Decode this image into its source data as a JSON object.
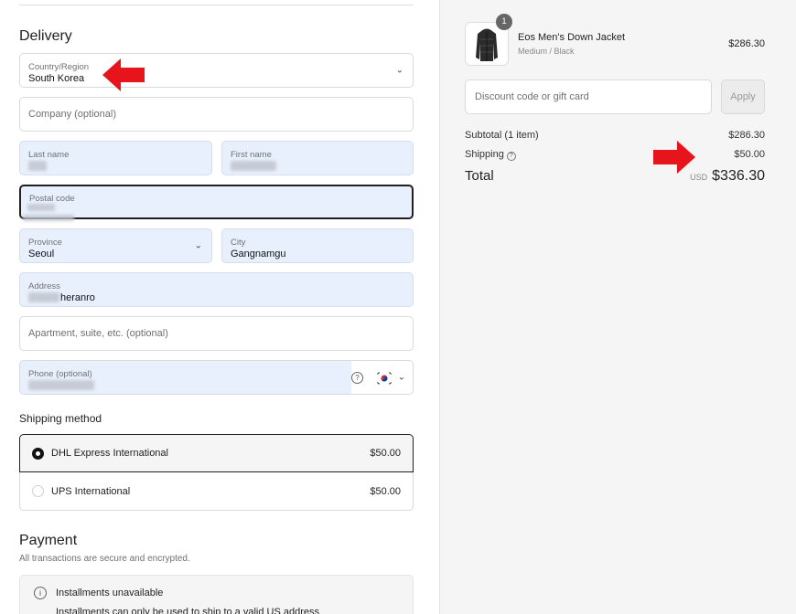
{
  "delivery": {
    "heading": "Delivery",
    "country": {
      "label": "Country/Region",
      "value": "South Korea"
    },
    "company": {
      "placeholder": "Company (optional)"
    },
    "last_name": {
      "label": "Last name"
    },
    "first_name": {
      "label": "First name"
    },
    "postal_code": {
      "label": "Postal code"
    },
    "province": {
      "label": "Province",
      "value": "Seoul"
    },
    "city": {
      "label": "City",
      "value": "Gangnamgu"
    },
    "address": {
      "label": "Address",
      "value": "heranro"
    },
    "apartment": {
      "placeholder": "Apartment, suite, etc. (optional)"
    },
    "phone": {
      "label": "Phone (optional)"
    }
  },
  "shipping_method": {
    "heading": "Shipping method",
    "options": [
      {
        "label": "DHL Express International",
        "price": "$50.00",
        "selected": true
      },
      {
        "label": "UPS International",
        "price": "$50.00",
        "selected": false
      }
    ]
  },
  "payment": {
    "heading": "Payment",
    "subtitle": "All transactions are secure and encrypted.",
    "notice_title": "Installments unavailable",
    "notice_text": "Installments can only be used to ship to a valid US address"
  },
  "order": {
    "item": {
      "quantity": "1",
      "name": "Eos Men's Down Jacket",
      "variant": "Medium / Black",
      "price": "$286.30"
    },
    "discount_placeholder": "Discount code or gift card",
    "apply_label": "Apply",
    "subtotal_label": "Subtotal (1 item)",
    "subtotal_value": "$286.30",
    "shipping_label": "Shipping",
    "shipping_value": "$50.00",
    "total_label": "Total",
    "currency": "USD",
    "total_value": "$336.30"
  },
  "colors": {
    "arrow": "#e8141b",
    "autofill": "#e8f0fe"
  }
}
